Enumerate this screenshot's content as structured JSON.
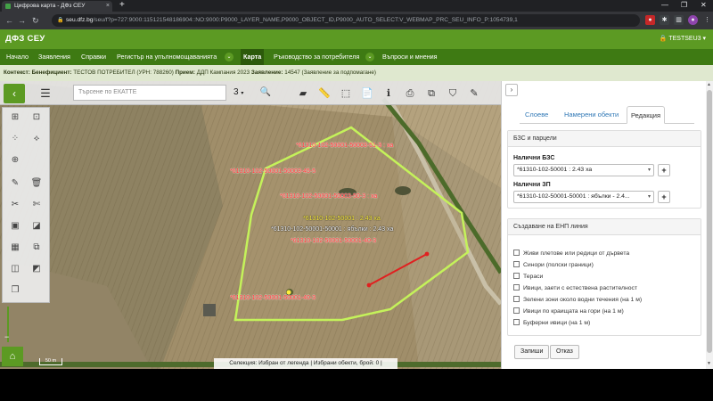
{
  "browser": {
    "tab_title": "Цифрова карта - ДФз СЕУ",
    "tab_close": "×",
    "new_tab": "+",
    "url_host": "seu.dfz.bg",
    "url_path": "/seu/f?p=727:9000:11512154818690​4::NO:9000:P9000_LAYER_NAME,P9000_OBJECT_ID,P9000_AUTO_SELECT:V_WEBMAP_PRC_SEU_INFO_P:1054739,1",
    "back": "←",
    "forward": "→",
    "reload": "↻",
    "window_min": "—",
    "window_max": "❐",
    "window_close": "✕"
  },
  "header": {
    "title": "ДФЗ СЕУ",
    "user": "TESTSEU3"
  },
  "menu": {
    "items": [
      {
        "label": "Начало"
      },
      {
        "label": "Заявления"
      },
      {
        "label": "Справки"
      },
      {
        "label": "Регистър на упълномощаванията"
      },
      {
        "label": "Карта"
      },
      {
        "label": "Ръководство за потребителя"
      },
      {
        "label": "Въпроси и мнения"
      }
    ],
    "caret": "⌄"
  },
  "context": {
    "k1": "Контекст:",
    "k2": "Бенефициент:",
    "v2": "ТЕСТОВ ПОТРЕБИТЕЛ (УРН: 788260)",
    "k3": "Прием:",
    "v3": "ДДП Кампания 2023",
    "k4": "Заявление:",
    "v4": "14547 (Заявление за подпомагане)"
  },
  "map": {
    "search_placeholder": "Търсене по ЕКАТТЕ",
    "zoom_value": "3",
    "scale_label": "50 m",
    "status_text": "Селекция: Избран от легенда  |  Избрани обекти, брой: 0  |",
    "labels": {
      "l1": "*61310-102-50001-50003-51-3 : ха",
      "l2": "*61310-102-50001-50003-45-5",
      "l3": "*61310-102-50001-50003-50-3 : ха",
      "l4": "*61310-102-50001 : 2.43 ха",
      "l5": "*61310-102-50001-50001 : ябълки : 2.43 ха",
      "l6": "*61310-102-50001-50001-40-3",
      "l7": "*61310-102-50001-50001-40-3"
    }
  },
  "panel": {
    "collapse": "›",
    "tabs": [
      "Слоеве",
      "Намерени обекти",
      "Редакция"
    ],
    "bzs_section_title": "БЗС и парцели",
    "bzs_label": "Налични БЗС",
    "bzs_value": "*61310-102-50001 : 2.43 ха",
    "zp_label": "Налични ЗП",
    "zp_value": "*61310-102-50001-50001 : ябълки - 2.4...",
    "plus": "+",
    "enp_section_title": "Създаване на ЕНП линия",
    "checkboxes": [
      "Живи плетове или редици от дървета",
      "Синори (полски граници)",
      "Тераси",
      "Ивици, заети с естествена растителност",
      "Зелени зони около водни течения (на 1 м)",
      "Ивици по краищата на гори (на 1 м)",
      "Буферни ивици (на 1 м)"
    ],
    "save_label": "Запиши",
    "cancel_label": "Отказ"
  },
  "colors": {
    "header_green": "#5c9a23",
    "menu_green": "#3e7a13",
    "parcel_outline": "#c4f25a",
    "line_red": "#e02020"
  }
}
